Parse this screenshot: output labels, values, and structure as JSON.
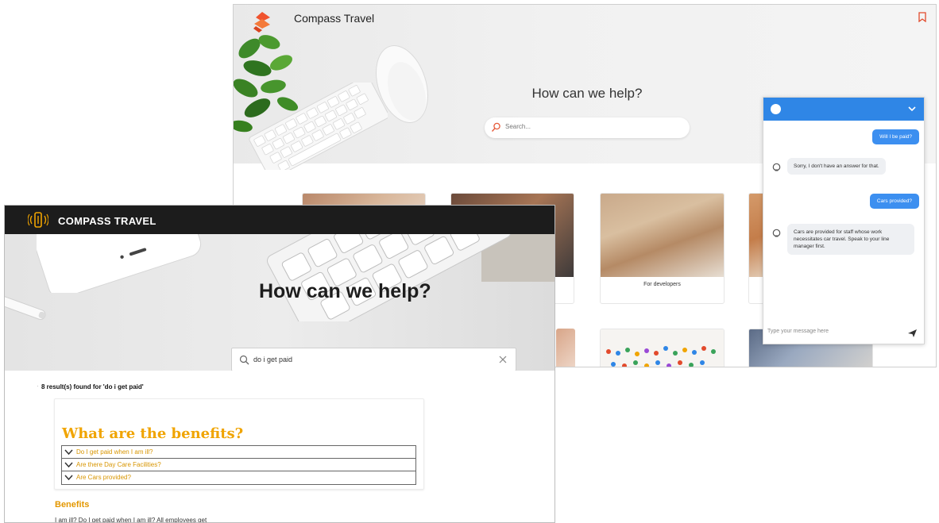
{
  "back_window": {
    "brand": "Compass Travel",
    "hero_title": "How can we help?",
    "search_placeholder": "Search...",
    "cards": [
      {
        "caption": ""
      },
      {
        "caption": ""
      },
      {
        "caption": "For developers"
      },
      {
        "caption": ""
      }
    ],
    "chat": {
      "messages": [
        {
          "from": "user",
          "text": "Will I be paid?"
        },
        {
          "from": "bot",
          "text": "Sorry, I don't have an answer for that."
        },
        {
          "from": "user",
          "text": "Cars provided?"
        },
        {
          "from": "bot",
          "text": "Cars are provided for staff whose work necessitates car travel. Speak to your line manager first."
        }
      ],
      "input_placeholder": "Type your message here"
    },
    "colors": {
      "accent": "#2f86e6",
      "logo": "#f0532e"
    }
  },
  "front_window": {
    "brand": "COMPASS TRAVEL",
    "hero_title": "How can we help?",
    "search_value": "do i get paid",
    "results_text": "8 result(s) found for 'do i get paid'",
    "result": {
      "title": "What are the benefits?",
      "faqs": [
        {
          "label": "Do I get paid when I am ill?"
        },
        {
          "label": "Are there Day Care Facilities?"
        },
        {
          "label": "Are Cars provided?"
        }
      ]
    },
    "section_heading": "Benefits",
    "section_text": "I am ill? Do I get paid when I am ill? All employees get",
    "colors": {
      "accent": "#f0a400",
      "topbar": "#1c1c1c"
    }
  }
}
